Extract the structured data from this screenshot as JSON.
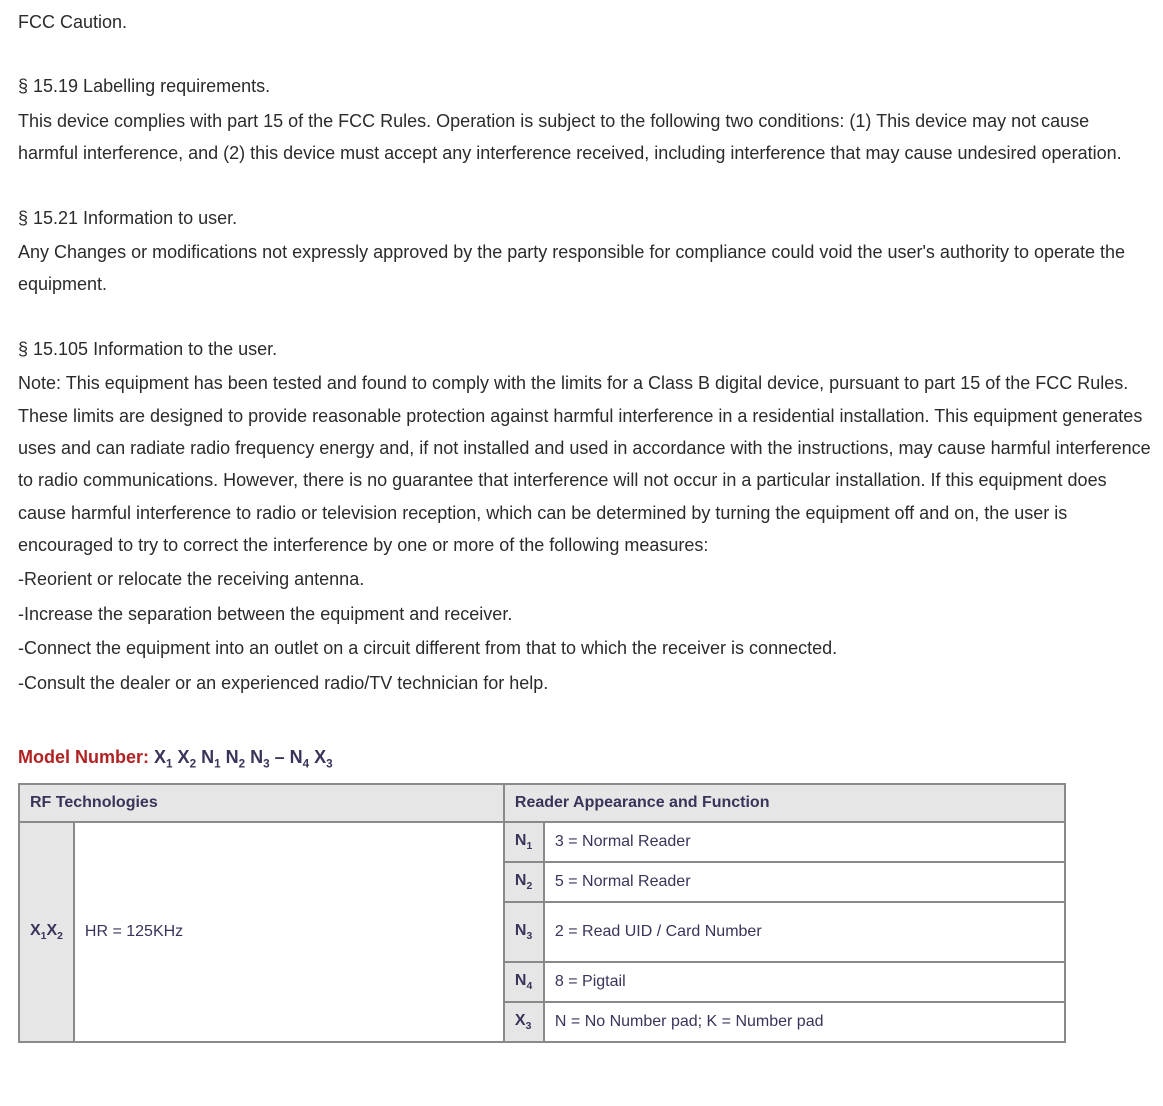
{
  "paragraphs": {
    "fcc_caution": "FCC Caution.",
    "s1519_title": "§ 15.19 Labelling requirements.",
    "s1519_body": "This device complies with part 15 of the FCC Rules. Operation is subject to the following two conditions: (1) This device may not cause harmful interference, and (2) this device must accept any interference received, including interference that may cause undesired operation.",
    "s1521_title": "§ 15.21 Information to user.",
    "s1521_body": "Any Changes or modifications not expressly approved by the party responsible for compliance could void the user's authority to operate the equipment.",
    "s15105_title": "§ 15.105 Information to the user.",
    "s15105_body": "Note: This equipment has been tested and found to comply with the limits for a Class B digital device, pursuant to part 15 of the FCC Rules. These limits are designed to provide reasonable protection against harmful interference in a residential installation. This equipment generates uses and can radiate radio frequency energy and, if not installed and used in accordance with the instructions, may cause harmful interference to radio communications. However, there is no guarantee that interference will not occur in a particular installation. If this equipment does cause harmful interference to radio or television reception, which can be determined by turning the equipment off and on, the user is encouraged to try to correct the interference by one or more of the following measures:",
    "measure1": "-Reorient or relocate the receiving antenna.",
    "measure2": "-Increase the separation between the equipment and receiver.",
    "measure3": "-Connect the equipment into an outlet on a circuit different from that to which the receiver is connected.",
    "measure4": "-Consult the dealer or an experienced radio/TV technician for help."
  },
  "model": {
    "label": "Model Number: ",
    "value_html": "X<sub>1</sub> X<sub>2</sub> N<sub>1</sub> N<sub>2</sub> N<sub>3</sub> – N<sub>4</sub> X<sub>3</sub>"
  },
  "table": {
    "header_left": "RF Technologies",
    "header_right": "Reader Appearance and Function",
    "x1x2_html": "X<sub>1</sub>X<sub>2</sub>",
    "hr_value": "HR = 125KHz",
    "rows": [
      {
        "key_html": "N<sub>1</sub>",
        "val": "3 = Normal Reader",
        "tall": false
      },
      {
        "key_html": "N<sub>2</sub>",
        "val": "5 = Normal Reader",
        "tall": false
      },
      {
        "key_html": "N<sub>3</sub>",
        "val": "2 = Read UID / Card Number",
        "tall": true
      },
      {
        "key_html": "N<sub>4</sub>",
        "val": "8 = Pigtail",
        "tall": false
      },
      {
        "key_html": "X<sub>3</sub>",
        "val": "N = No Number pad; K = Number pad",
        "tall": false
      }
    ]
  }
}
